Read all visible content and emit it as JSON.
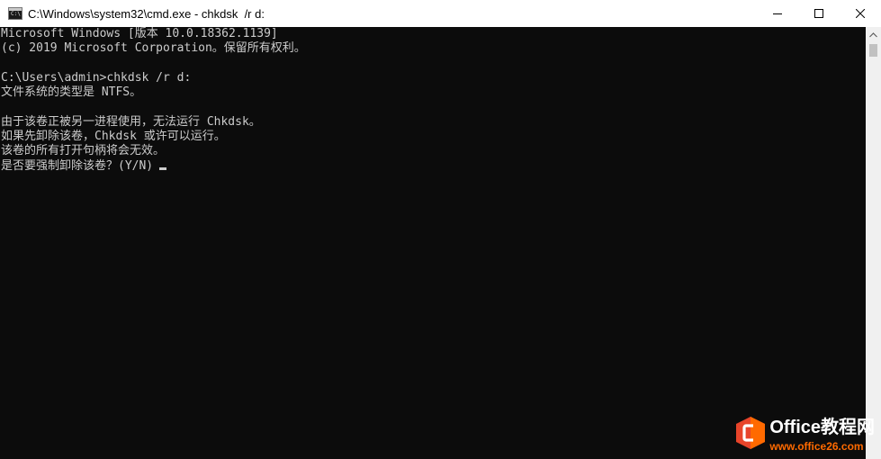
{
  "window": {
    "title": "C:\\Windows\\system32\\cmd.exe - chkdsk  /r d:",
    "app_icon_label": "C:\\",
    "icons": {
      "app": "cmd-app-icon",
      "minimize": "minimize-icon",
      "maximize": "maximize-icon",
      "close": "close-icon"
    }
  },
  "console": {
    "lines": [
      "Microsoft Windows [版本 10.0.18362.1139]",
      "(c) 2019 Microsoft Corporation。保留所有权利。",
      "",
      "C:\\Users\\admin>chkdsk /r d:",
      "文件系统的类型是 NTFS。",
      "",
      "由于该卷正被另一进程使用，无法运行 Chkdsk。",
      "如果先卸除该卷，Chkdsk 或许可以运行。",
      "该卷的所有打开句柄将会无效。",
      "是否要强制卸除该卷？(Y/N)"
    ],
    "colors": {
      "background": "#0c0c0c",
      "text": "#cccccc"
    }
  },
  "watermark": {
    "brand": "Office教程网",
    "url": "www.office26.com",
    "colors": {
      "orange": "#ff6a00",
      "red": "#e8442a"
    }
  }
}
